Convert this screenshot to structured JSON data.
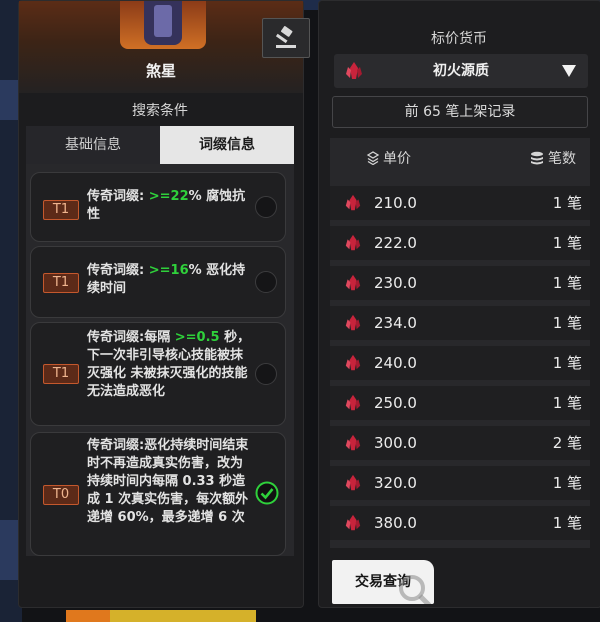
{
  "item": {
    "name": "煞星",
    "thumbnail_icon": "armor-chest-icon"
  },
  "search": {
    "title": "搜索条件"
  },
  "tabs": [
    {
      "label": "基础信息",
      "active": false
    },
    {
      "label": "词缀信息",
      "active": true
    }
  ],
  "affixes": [
    {
      "tier": "T1",
      "prefix": "传奇词缀: ",
      "value": ">=22",
      "suffix": "% 腐蚀抗性",
      "selected": false
    },
    {
      "tier": "T1",
      "prefix": "传奇词缀: ",
      "value": ">=16",
      "suffix": "% 恶化持续时间",
      "selected": false
    },
    {
      "tier": "T1",
      "prefix": "传奇词缀:每隔 ",
      "value": ">=0.5",
      "suffix": " 秒，下一次非引导核心技能被抹灭强化 未被抹灭强化的技能无法造成恶化",
      "selected": false
    },
    {
      "tier": "T0",
      "prefix": "传奇词缀:恶化持续时间结束时不再造成真实伤害，改为持续时间内每隔 0.33 秒造成 1 次真实伤害，每次额外递增 60%，最多递增 6 次",
      "value": "",
      "suffix": "",
      "selected": true
    }
  ],
  "currency": {
    "title": "标价货币",
    "selected": "初火源质",
    "icon": "red-crystal-icon"
  },
  "records": {
    "label": "前 65 笔上架记录"
  },
  "table": {
    "headers": {
      "price": "单价",
      "count": "笔数"
    },
    "rows": [
      {
        "price": "210.0",
        "count": "1 笔"
      },
      {
        "price": "222.0",
        "count": "1 笔"
      },
      {
        "price": "230.0",
        "count": "1 笔"
      },
      {
        "price": "234.0",
        "count": "1 笔"
      },
      {
        "price": "240.0",
        "count": "1 笔"
      },
      {
        "price": "250.0",
        "count": "1 笔"
      },
      {
        "price": "300.0",
        "count": "2 笔"
      },
      {
        "price": "320.0",
        "count": "1 笔"
      },
      {
        "price": "380.0",
        "count": "1 笔"
      }
    ]
  },
  "trade": {
    "label": "交易查询"
  },
  "colors": {
    "accent_green": "#2fd13b",
    "tier_border": "#c4582d",
    "crystal": "#c8243c"
  }
}
